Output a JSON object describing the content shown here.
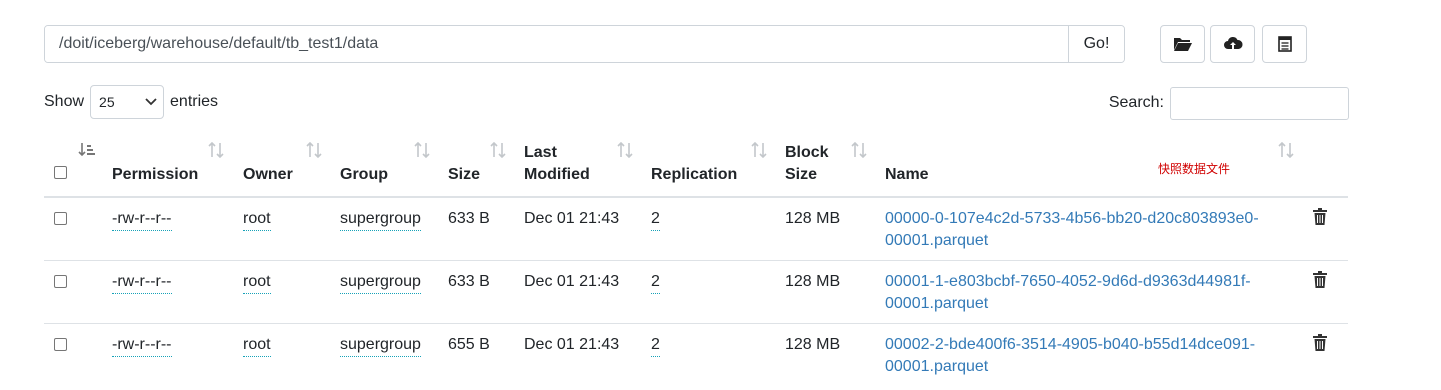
{
  "path": {
    "value": "/doit/iceberg/warehouse/default/tb_test1/data",
    "go_label": "Go!"
  },
  "toolbar": {
    "icons": [
      "folder-open-icon",
      "cloud-upload-icon",
      "clipboard-list-icon"
    ]
  },
  "length_control": {
    "show_label": "Show",
    "selected": "25",
    "entries_label": "entries"
  },
  "search": {
    "label": "Search:",
    "value": ""
  },
  "columns": {
    "permission": "Permission",
    "owner": "Owner",
    "group": "Group",
    "size": "Size",
    "last_modified_1": "Last",
    "last_modified_2": "Modified",
    "replication": "Replication",
    "block_size_1": "Block",
    "block_size_2": "Size",
    "name": "Name"
  },
  "annotation": "快照数据文件",
  "rows": [
    {
      "permission": "-rw-r--r--",
      "owner": "root",
      "group": "supergroup",
      "size": "633 B",
      "last_modified": "Dec 01 21:43",
      "replication": "2",
      "block_size": "128 MB",
      "name_line1": "00000-0-107e4c2d-5733-4b56-bb20-d20c803893e0-",
      "name_line2": "00001.parquet"
    },
    {
      "permission": "-rw-r--r--",
      "owner": "root",
      "group": "supergroup",
      "size": "633 B",
      "last_modified": "Dec 01 21:43",
      "replication": "2",
      "block_size": "128 MB",
      "name_line1": "00001-1-e803bcbf-7650-4052-9d6d-d9363d44981f-",
      "name_line2": "00001.parquet"
    },
    {
      "permission": "-rw-r--r--",
      "owner": "root",
      "group": "supergroup",
      "size": "655 B",
      "last_modified": "Dec 01 21:43",
      "replication": "2",
      "block_size": "128 MB",
      "name_line1": "00002-2-bde400f6-3514-4905-b040-b55d14dce091-",
      "name_line2": "00001.parquet"
    }
  ]
}
